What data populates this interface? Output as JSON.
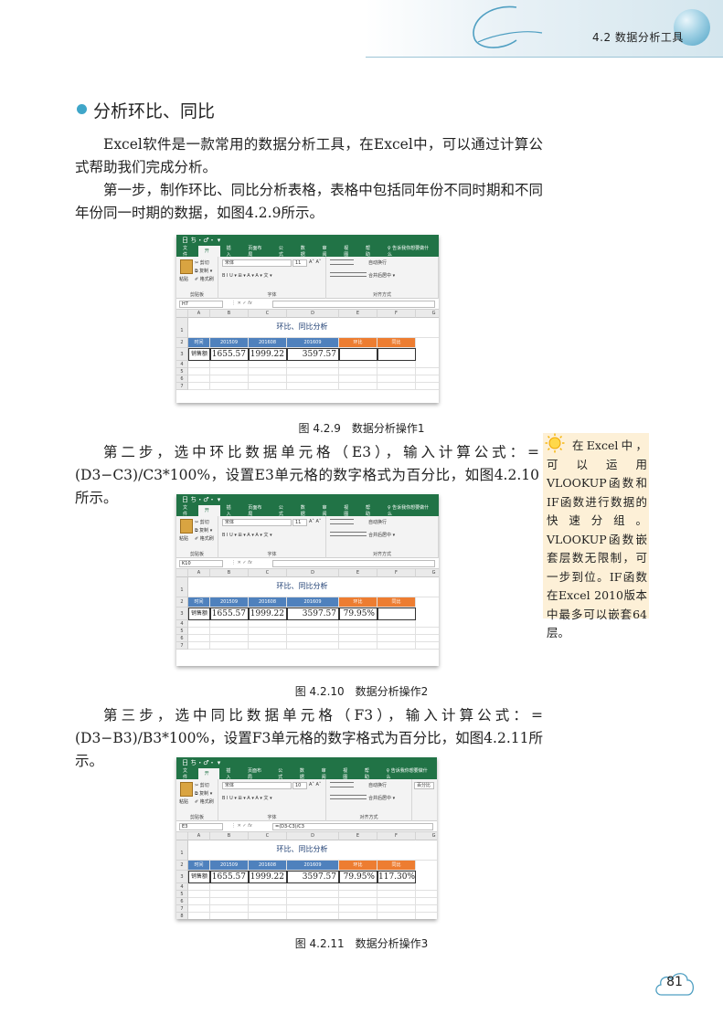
{
  "header": {
    "section_title": "4.2  数据分析工具"
  },
  "heading": "分析环比、同比",
  "paragraphs": {
    "p1": "Excel软件是一款常用的数据分析工具，在Excel中，可以通过计算公式帮助我们完成分析。",
    "p2": "第一步，制作环比、同比分析表格，表格中包括同年份不同时期和不同年份同一时期的数据，如图4.2.9所示。",
    "p3": "第二步，选中环比数据单元格（E3），输入计算公式：=(D3−C3)/C3*100%，设置E3单元格的数字格式为百分比，如图4.2.10所示。",
    "p4": "第三步，选中同比数据单元格（F3），输入计算公式：=(D3−B3)/B3*100%，设置F3单元格的数字格式为百分比，如图4.2.11所示。"
  },
  "captions": {
    "fig1": "图 4.2.9　数据分析操作1",
    "fig2": "图 4.2.10　数据分析操作2",
    "fig3": "图 4.2.11　数据分析操作3"
  },
  "tip": "在Excel中，可以运用VLOOKUP函数和IF函数进行数据的快速分组。VLOOKUP函数嵌套层数无限制，可一步到位。IF函数在Excel 2010版本中最多可以嵌套64层。",
  "page_number": "81",
  "excel": {
    "quick_access": "日 ち・♂・ ▾",
    "tabs": [
      "文件",
      "开始",
      "插入",
      "页面布局",
      "公式",
      "数据",
      "审阅",
      "视图",
      "帮助",
      "♀ 告诉我你想要做什么"
    ],
    "clipboard": {
      "paste": "粘贴",
      "cut": "✂ 剪切",
      "copy": "⧉ 复制 ▾",
      "painter": "✐ 格式刷",
      "label": "剪贴板"
    },
    "font_group": {
      "label": "字体",
      "bius": "B  I  U ▾  ⊞ ▾  A ▾  A ▾  文 ▾",
      "grow": "A˄ A˅"
    },
    "align_group": {
      "label": "对齐方式",
      "wrap": "自动换行",
      "merge": "合并后居中 ▾"
    },
    "number_group": {
      "format": "百分比",
      "label": ""
    },
    "col_headers": [
      "A",
      "B",
      "C",
      "D",
      "E",
      "F",
      "G"
    ],
    "table_title": "环比、同比分析",
    "header_row": [
      "时间",
      "201509",
      "201608",
      "201609",
      "环比",
      "同比"
    ],
    "data_label": "销售额",
    "values": [
      "1655.57",
      "1999.22",
      "3597.57"
    ],
    "fig1": {
      "namebox": "H7",
      "font": "宋体",
      "size": "11",
      "formula": "",
      "e3": "",
      "f3": ""
    },
    "fig2": {
      "namebox": "K10",
      "font": "宋体",
      "size": "11",
      "formula": "",
      "e3": "79.95%",
      "f3": ""
    },
    "fig3": {
      "namebox": "E3",
      "font": "宋体",
      "size": "10",
      "formula": "=(D3-C3)/C3",
      "e3": "79.95%",
      "f3": "117.30%"
    },
    "row_numbers": [
      "1",
      "2",
      "3",
      "4",
      "5",
      "6",
      "7",
      "8"
    ]
  },
  "colors": {
    "accent": "#3fa6c9",
    "excel_green": "#217346",
    "header_blue": "#4f81bd",
    "header_orange": "#ed7d31",
    "tip_bg": "#fdf0d7"
  }
}
